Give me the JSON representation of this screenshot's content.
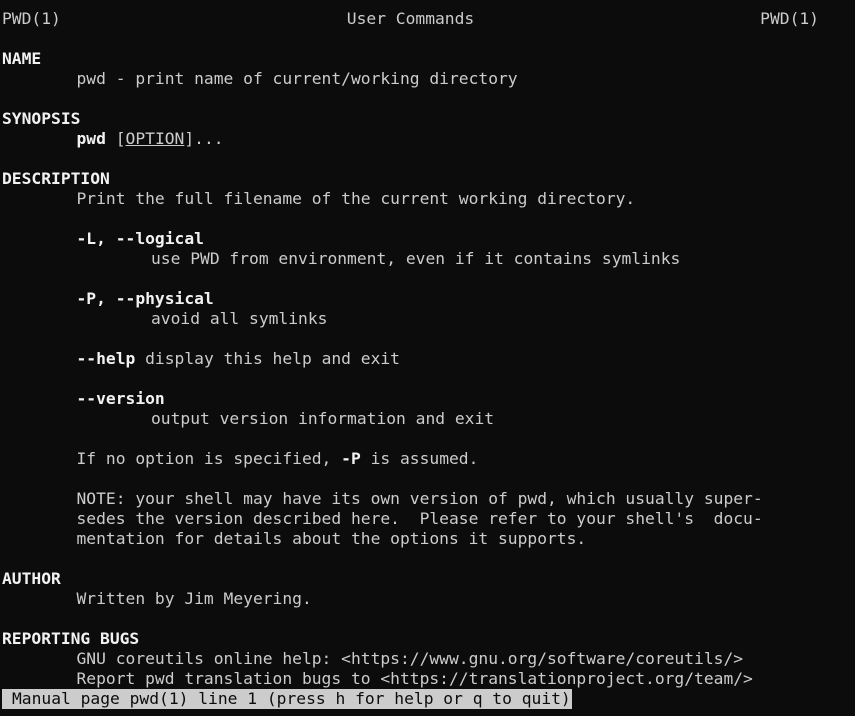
{
  "header": {
    "left": "PWD(1)",
    "center": "User Commands",
    "right": "PWD(1)"
  },
  "sections": {
    "name": {
      "heading": "NAME",
      "text": "pwd - print name of current/working directory"
    },
    "synopsis": {
      "heading": "SYNOPSIS",
      "command": "pwd",
      "open_bracket": " [",
      "option": "OPTION",
      "close": "]..."
    },
    "description": {
      "heading": "DESCRIPTION",
      "intro": "Print the full filename of the current working directory.",
      "logical_flag": "-L, --logical",
      "logical_desc": "use PWD from environment, even if it contains symlinks",
      "physical_flag": "-P, --physical",
      "physical_desc": "avoid all symlinks",
      "help_flag": "--help",
      "help_desc": " display this help and exit",
      "version_flag": "--version",
      "version_desc": "output version information and exit",
      "default_pre": "If no option is specified, ",
      "default_flag": "-P",
      "default_post": " is assumed.",
      "note_lines": [
        "NOTE: your shell may have its own version of pwd, which usually super-",
        "sedes the version described here.  Please refer to your shell's  docu-",
        "mentation for details about the options it supports."
      ]
    },
    "author": {
      "heading": "AUTHOR",
      "text": "Written by Jim Meyering."
    },
    "reporting_bugs": {
      "heading": "REPORTING BUGS",
      "lines": [
        "GNU coreutils online help: <https://www.gnu.org/software/coreutils/>",
        "Report pwd translation bugs to <https://translationproject.org/team/>"
      ]
    }
  },
  "status_bar": {
    "text": "Manual page pwd(1) line 1 (press h for help or q to quit)"
  },
  "colors": {
    "background": "#0c0c0c",
    "foreground": "#cccccc",
    "bold": "#f2f2f2"
  }
}
